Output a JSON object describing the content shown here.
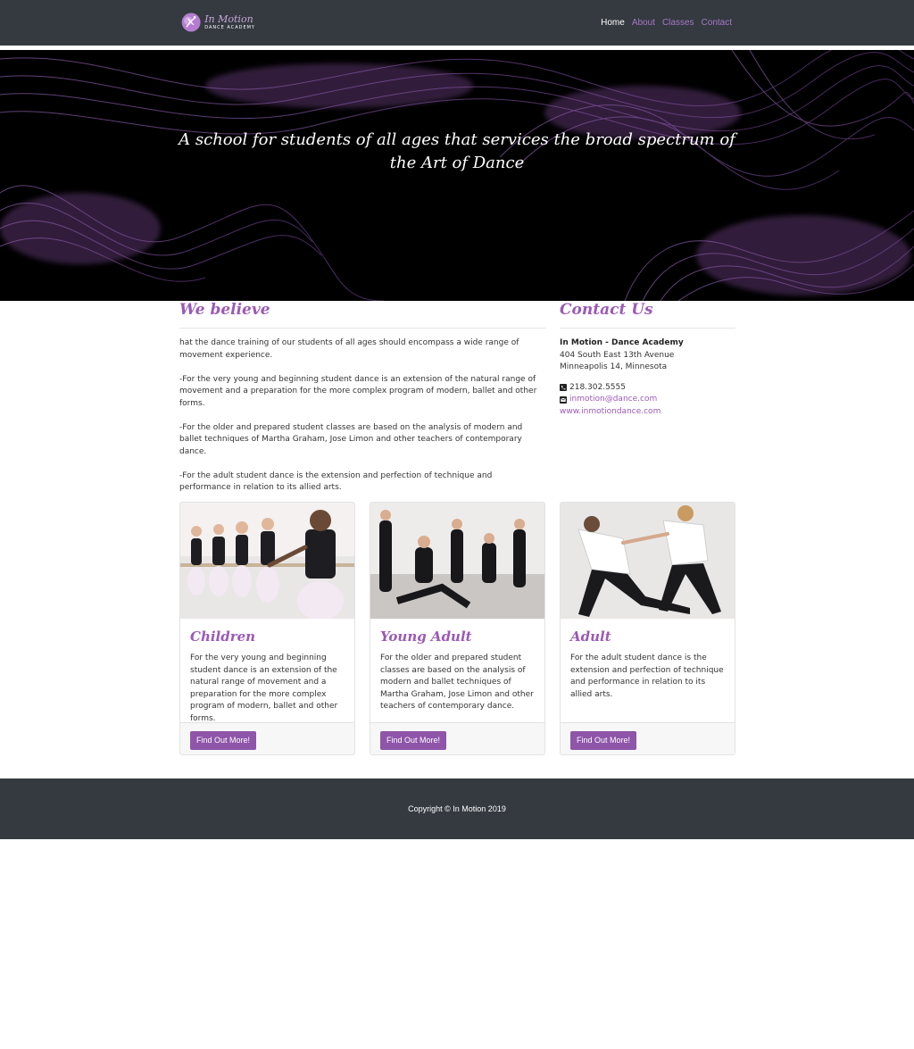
{
  "brand": {
    "name": "In Motion",
    "subtitle": "DANCE ACADEMY",
    "accent_color": "#9b59b6"
  },
  "nav": {
    "items": [
      {
        "label": "Home",
        "active": true
      },
      {
        "label": "About",
        "active": false
      },
      {
        "label": "Classes",
        "active": false
      },
      {
        "label": "Contact",
        "active": false
      }
    ]
  },
  "hero": {
    "tagline": "A school for students of all ages that services the broad spectrum of the Art of Dance"
  },
  "believe": {
    "heading": "We believe",
    "paragraphs": [
      "hat the dance training of our students of all ages should encompass a wide range of movement experience.",
      "-For the very young and beginning student dance is an extension of the natural range of movement and a preparation for the more complex program of modern, ballet and other forms.",
      "-For the older and prepared student classes are based on the analysis of modern and ballet techniques of Martha Graham, Jose Limon and other teachers of contemporary dance.",
      "-For the adult student dance is the extension and perfection of technique and performance in relation to its allied arts."
    ]
  },
  "contact": {
    "heading": "Contact Us",
    "org": "In Motion - Dance Academy",
    "address_line1": "404 South East 13th Avenue",
    "address_line2": "Minneapolis 14, Minnesota",
    "phone": "218.302.5555",
    "email": "inmotion@dance.com",
    "website": "www.inmotiondance.com"
  },
  "cards": [
    {
      "title": "Children",
      "text": "For the very young and beginning student dance is an extension of the natural range of movement and a preparation for the more complex program of modern, ballet and other forms.",
      "button": "Find Out More!"
    },
    {
      "title": "Young Adult",
      "text": "For the older and prepared student classes are based on the analysis of modern and ballet techniques of Martha Graham, Jose Limon and other teachers of contemporary dance.",
      "button": "Find Out More!"
    },
    {
      "title": "Adult",
      "text": "For the adult student dance is the extension and perfection of technique and performance in relation to its allied arts.",
      "button": "Find Out More!"
    }
  ],
  "footer": {
    "copyright": "Copyright © In Motion 2019"
  }
}
